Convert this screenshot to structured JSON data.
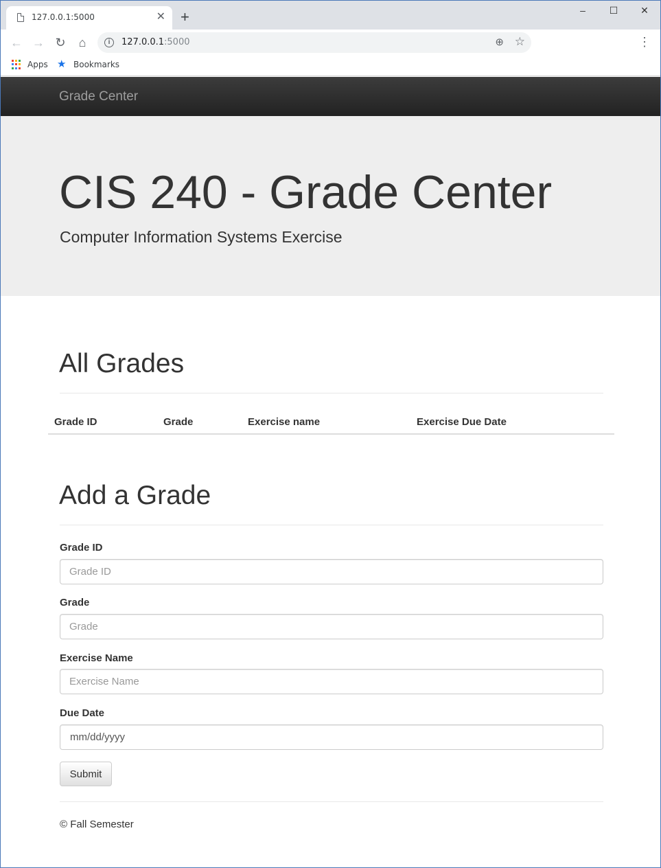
{
  "browser": {
    "tab_title": "127.0.0.1:5000",
    "tab_close": "✕",
    "new_tab": "+",
    "minimize": "–",
    "maximize": "☐",
    "close": "✕",
    "back": "←",
    "forward": "→",
    "reload": "↻",
    "home": "⌂",
    "url_host": "127.0.0.1",
    "url_port": ":5000",
    "zoom_icon": "⊕",
    "star": "☆",
    "menu": "⋮",
    "bookmarks": {
      "apps_label": "Apps",
      "bookmarks_label": "Bookmarks",
      "bookmarks_star": "★"
    }
  },
  "navbar": {
    "brand": "Grade Center"
  },
  "jumbotron": {
    "title": "CIS 240 - Grade Center",
    "subtitle": "Computer Information Systems Exercise"
  },
  "all_grades": {
    "title": "All Grades",
    "columns": [
      "Grade ID",
      "Grade",
      "Exercise name",
      "Exercise Due Date"
    ],
    "rows": []
  },
  "add_grade": {
    "title": "Add a Grade",
    "fields": {
      "grade_id": {
        "label": "Grade ID",
        "placeholder": "Grade ID",
        "value": ""
      },
      "grade": {
        "label": "Grade",
        "placeholder": "Grade",
        "value": ""
      },
      "exercise_name": {
        "label": "Exercise Name",
        "placeholder": "Exercise Name",
        "value": ""
      },
      "due_date": {
        "label": "Due Date",
        "placeholder": "mm/dd/yyyy"
      }
    },
    "submit_label": "Submit"
  },
  "footer": {
    "text": "© Fall Semester"
  },
  "colors": {
    "navbar": "#222222",
    "jumbotron": "#eeeeee",
    "window_border": "#4a78b8",
    "bookmark_star": "#1a73e8"
  }
}
